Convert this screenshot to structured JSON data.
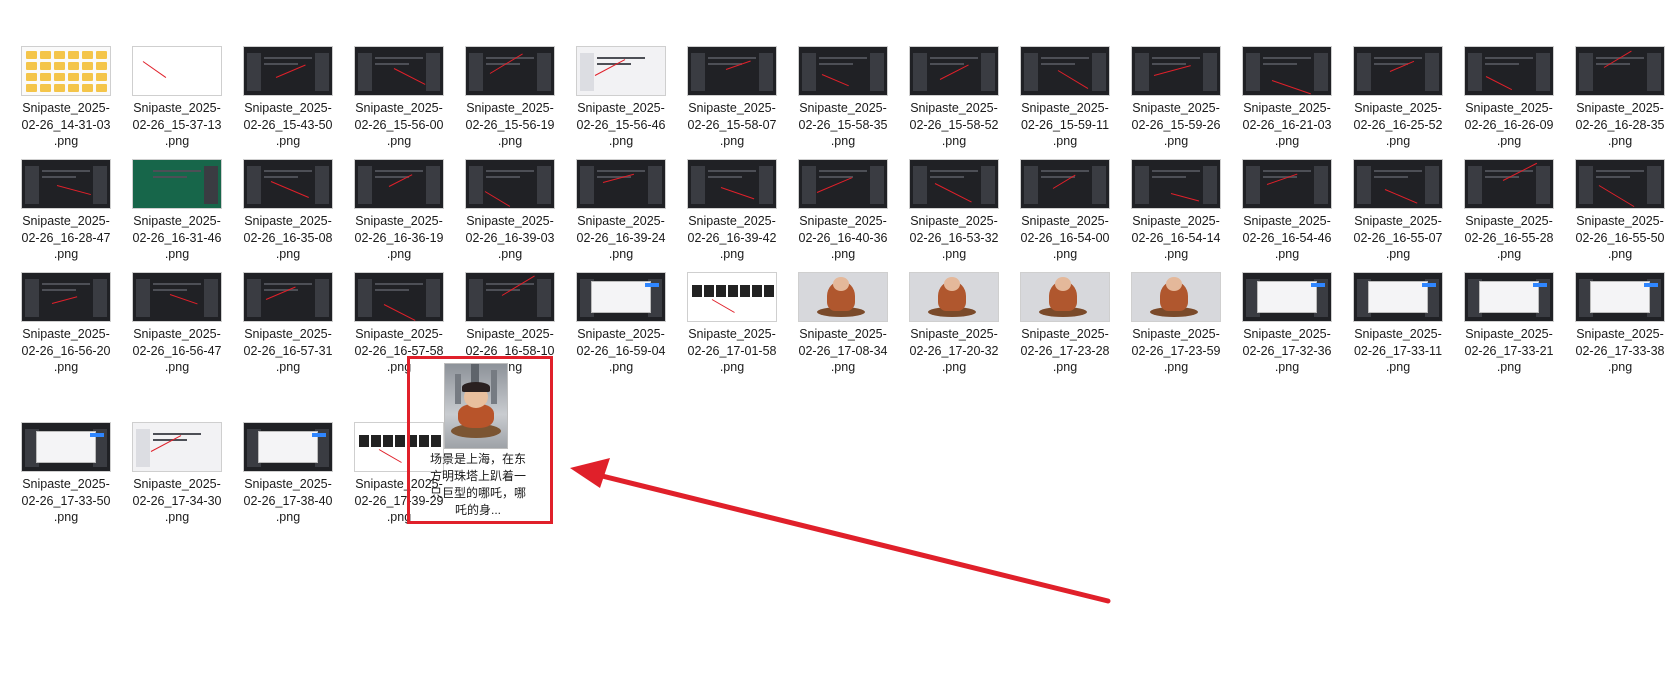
{
  "files": [
    {
      "name_line1": "Snipaste_2025-",
      "name_line2": "02-26_14-31-03",
      "ext": ".png",
      "thumb": "folder-grid"
    },
    {
      "name_line1": "Snipaste_2025-",
      "name_line2": "02-26_15-37-13",
      "ext": ".png",
      "thumb": "light-blank"
    },
    {
      "name_line1": "Snipaste_2025-",
      "name_line2": "02-26_15-43-50",
      "ext": ".png",
      "thumb": "dark-editor"
    },
    {
      "name_line1": "Snipaste_2025-",
      "name_line2": "02-26_15-56-00",
      "ext": ".png",
      "thumb": "dark-editor"
    },
    {
      "name_line1": "Snipaste_2025-",
      "name_line2": "02-26_15-56-19",
      "ext": ".png",
      "thumb": "dark-editor"
    },
    {
      "name_line1": "Snipaste_2025-",
      "name_line2": "02-26_15-56-46",
      "ext": ".png",
      "thumb": "light-window"
    },
    {
      "name_line1": "Snipaste_2025-",
      "name_line2": "02-26_15-58-07",
      "ext": ".png",
      "thumb": "dark-editor"
    },
    {
      "name_line1": "Snipaste_2025-",
      "name_line2": "02-26_15-58-35",
      "ext": ".png",
      "thumb": "dark-editor"
    },
    {
      "name_line1": "Snipaste_2025-",
      "name_line2": "02-26_15-58-52",
      "ext": ".png",
      "thumb": "dark-editor"
    },
    {
      "name_line1": "Snipaste_2025-",
      "name_line2": "02-26_15-59-11",
      "ext": ".png",
      "thumb": "dark-editor"
    },
    {
      "name_line1": "Snipaste_2025-",
      "name_line2": "02-26_15-59-26",
      "ext": ".png",
      "thumb": "dark-editor"
    },
    {
      "name_line1": "Snipaste_2025-",
      "name_line2": "02-26_16-21-03",
      "ext": ".png",
      "thumb": "dark-editor"
    },
    {
      "name_line1": "Snipaste_2025-",
      "name_line2": "02-26_16-25-52",
      "ext": ".png",
      "thumb": "dark-editor"
    },
    {
      "name_line1": "Snipaste_2025-",
      "name_line2": "02-26_16-26-09",
      "ext": ".png",
      "thumb": "dark-editor"
    },
    {
      "name_line1": "Snipaste_2025-",
      "name_line2": "02-26_16-28-35",
      "ext": ".png",
      "thumb": "dark-editor"
    },
    {
      "name_line1": "Snipaste_2025-",
      "name_line2": "02-26_16-28-47",
      "ext": ".png",
      "thumb": "dark-editor"
    },
    {
      "name_line1": "Snipaste_2025-",
      "name_line2": "02-26_16-31-46",
      "ext": ".png",
      "thumb": "green-editor"
    },
    {
      "name_line1": "Snipaste_2025-",
      "name_line2": "02-26_16-35-08",
      "ext": ".png",
      "thumb": "dark-editor"
    },
    {
      "name_line1": "Snipaste_2025-",
      "name_line2": "02-26_16-36-19",
      "ext": ".png",
      "thumb": "dark-editor"
    },
    {
      "name_line1": "Snipaste_2025-",
      "name_line2": "02-26_16-39-03",
      "ext": ".png",
      "thumb": "dark-editor"
    },
    {
      "name_line1": "Snipaste_2025-",
      "name_line2": "02-26_16-39-24",
      "ext": ".png",
      "thumb": "dark-editor"
    },
    {
      "name_line1": "Snipaste_2025-",
      "name_line2": "02-26_16-39-42",
      "ext": ".png",
      "thumb": "dark-editor"
    },
    {
      "name_line1": "Snipaste_2025-",
      "name_line2": "02-26_16-40-36",
      "ext": ".png",
      "thumb": "dark-editor"
    },
    {
      "name_line1": "Snipaste_2025-",
      "name_line2": "02-26_16-53-32",
      "ext": ".png",
      "thumb": "dark-editor"
    },
    {
      "name_line1": "Snipaste_2025-",
      "name_line2": "02-26_16-54-00",
      "ext": ".png",
      "thumb": "dark-editor"
    },
    {
      "name_line1": "Snipaste_2025-",
      "name_line2": "02-26_16-54-14",
      "ext": ".png",
      "thumb": "dark-editor"
    },
    {
      "name_line1": "Snipaste_2025-",
      "name_line2": "02-26_16-54-46",
      "ext": ".png",
      "thumb": "dark-editor"
    },
    {
      "name_line1": "Snipaste_2025-",
      "name_line2": "02-26_16-55-07",
      "ext": ".png",
      "thumb": "dark-editor"
    },
    {
      "name_line1": "Snipaste_2025-",
      "name_line2": "02-26_16-55-28",
      "ext": ".png",
      "thumb": "dark-editor"
    },
    {
      "name_line1": "Snipaste_2025-",
      "name_line2": "02-26_16-55-50",
      "ext": ".png",
      "thumb": "dark-editor"
    },
    {
      "name_line1": "Snipaste_2025-",
      "name_line2": "02-26_16-56-20",
      "ext": ".png",
      "thumb": "dark-editor"
    },
    {
      "name_line1": "Snipaste_2025-",
      "name_line2": "02-26_16-56-47",
      "ext": ".png",
      "thumb": "dark-editor"
    },
    {
      "name_line1": "Snipaste_2025-",
      "name_line2": "02-26_16-57-31",
      "ext": ".png",
      "thumb": "dark-editor"
    },
    {
      "name_line1": "Snipaste_2025-",
      "name_line2": "02-26_16-57-58",
      "ext": ".png",
      "thumb": "dark-editor"
    },
    {
      "name_line1": "Snipaste_2025-",
      "name_line2": "02-26_16-58-10",
      "ext": ".png",
      "thumb": "dark-editor"
    },
    {
      "name_line1": "Snipaste_2025-",
      "name_line2": "02-26_16-59-04",
      "ext": ".png",
      "thumb": "dark-dialog"
    },
    {
      "name_line1": "Snipaste_2025-",
      "name_line2": "02-26_17-01-58",
      "ext": ".png",
      "thumb": "film-strip"
    },
    {
      "name_line1": "Snipaste_2025-",
      "name_line2": "02-26_17-08-34",
      "ext": ".png",
      "thumb": "photo-figure"
    },
    {
      "name_line1": "Snipaste_2025-",
      "name_line2": "02-26_17-20-32",
      "ext": ".png",
      "thumb": "photo-figure"
    },
    {
      "name_line1": "Snipaste_2025-",
      "name_line2": "02-26_17-23-28",
      "ext": ".png",
      "thumb": "photo-figure"
    },
    {
      "name_line1": "Snipaste_2025-",
      "name_line2": "02-26_17-23-59",
      "ext": ".png",
      "thumb": "photo-figure"
    },
    {
      "name_line1": "Snipaste_2025-",
      "name_line2": "02-26_17-32-36",
      "ext": ".png",
      "thumb": "dark-dialog"
    },
    {
      "name_line1": "Snipaste_2025-",
      "name_line2": "02-26_17-33-11",
      "ext": ".png",
      "thumb": "dark-dialog"
    },
    {
      "name_line1": "Snipaste_2025-",
      "name_line2": "02-26_17-33-21",
      "ext": ".png",
      "thumb": "dark-dialog"
    },
    {
      "name_line1": "Snipaste_2025-",
      "name_line2": "02-26_17-33-38",
      "ext": ".png",
      "thumb": "dark-dialog"
    },
    {
      "name_line1": "Snipaste_2025-",
      "name_line2": "02-26_17-33-50",
      "ext": ".png",
      "thumb": "dark-dialog"
    },
    {
      "name_line1": "Snipaste_2025-",
      "name_line2": "02-26_17-34-30",
      "ext": ".png",
      "thumb": "light-window"
    },
    {
      "name_line1": "Snipaste_2025-",
      "name_line2": "02-26_17-38-40",
      "ext": ".png",
      "thumb": "dark-dialog"
    },
    {
      "name_line1": "Snipaste_2025-",
      "name_line2": "02-26_17-39-29",
      "ext": ".png",
      "thumb": "film-strip"
    }
  ],
  "selected_file": {
    "caption": "场景是上海，在东方明珠塔上趴着一只巨型的哪吒，哪吒的身...",
    "thumb": "nezha-portrait"
  },
  "annotation": {
    "highlight_color": "#e0202a",
    "arrow_color": "#e0202a",
    "type": "red-box-and-arrow"
  }
}
